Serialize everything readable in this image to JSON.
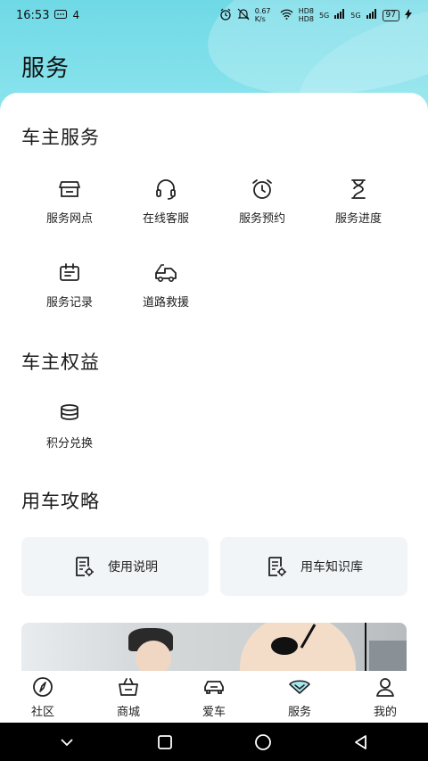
{
  "status_bar": {
    "time": "16:53",
    "msg_count": "4",
    "net_speed": "0.67 K/s",
    "hd1": "HD8",
    "hd2": "HD8",
    "sig1": "5G",
    "sig2": "5G",
    "battery": "97",
    "icons": [
      "alarm-icon",
      "mute-icon",
      "wifi-icon",
      "signal-icon",
      "charging-icon"
    ]
  },
  "header": {
    "title": "服务",
    "color": "#6fd9e6"
  },
  "sections": {
    "owner_services": {
      "title": "车主服务",
      "items": [
        {
          "label": "服务网点",
          "icon": "store-icon"
        },
        {
          "label": "在线客服",
          "icon": "headset-icon"
        },
        {
          "label": "服务预约",
          "icon": "alarm-clock-icon"
        },
        {
          "label": "服务进度",
          "icon": "hourglass-icon"
        },
        {
          "label": "服务记录",
          "icon": "record-icon"
        },
        {
          "label": "道路救援",
          "icon": "tow-truck-icon"
        }
      ]
    },
    "owner_benefits": {
      "title": "车主权益",
      "items": [
        {
          "label": "积分兑换",
          "icon": "coins-icon"
        }
      ]
    },
    "car_guide": {
      "title": "用车攻略",
      "cards": [
        {
          "label": "使用说明",
          "icon": "doc-gear-icon"
        },
        {
          "label": "用车知识库",
          "icon": "doc-gear-icon"
        }
      ]
    }
  },
  "tabbar": {
    "active": "服务",
    "accent": "#5cc8d8",
    "tabs": [
      {
        "label": "社区",
        "icon": "compass-icon"
      },
      {
        "label": "商城",
        "icon": "basket-icon"
      },
      {
        "label": "爱车",
        "icon": "car-icon"
      },
      {
        "label": "服务",
        "icon": "service-icon"
      },
      {
        "label": "我的",
        "icon": "person-icon"
      }
    ]
  },
  "navbar": {
    "icons": [
      "chevron-down-icon",
      "recent-apps-icon",
      "home-icon",
      "back-icon"
    ]
  }
}
